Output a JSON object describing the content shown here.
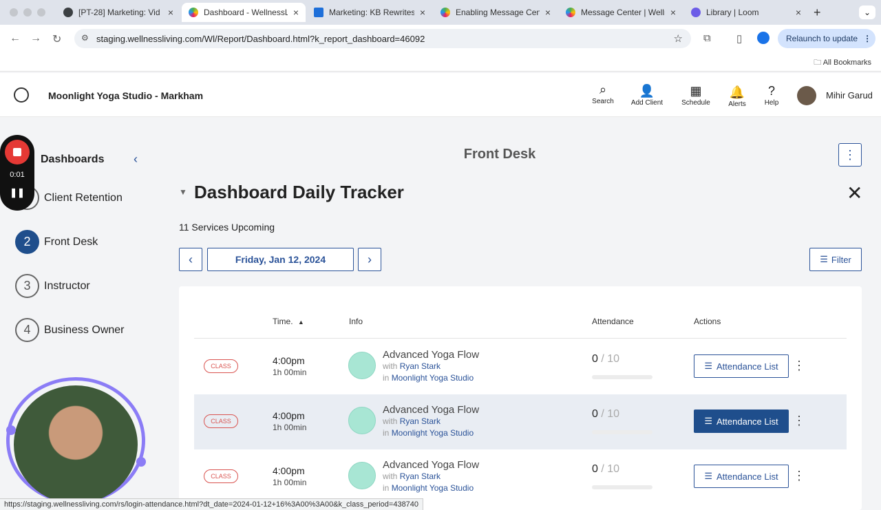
{
  "browser": {
    "tabs": [
      {
        "title": "[PT-28] Marketing: Vid",
        "favicon_color": "#3c4043"
      },
      {
        "title": "Dashboard - WellnessLi",
        "favicon_color": "#4caf50",
        "active": true
      },
      {
        "title": "Marketing: KB Rewrites",
        "favicon_color": "#1e6fd9"
      },
      {
        "title": "Enabling Message Cent",
        "favicon_color": "#8bc34a"
      },
      {
        "title": "Message Center | Welln",
        "favicon_color": "#8bc34a"
      },
      {
        "title": "Library | Loom",
        "favicon_color": "#6c5ce7"
      }
    ],
    "url": "staging.wellnessliving.com/Wl/Report/Dashboard.html?k_report_dashboard=46092",
    "relaunch_label": "Relaunch to update",
    "all_bookmarks_label": "All Bookmarks",
    "status_url": "https://staging.wellnessliving.com/rs/login-attendance.html?dt_date=2024-01-12+16%3A00%3A00&k_class_period=438740"
  },
  "header": {
    "studio_name": "Moonlight Yoga Studio - Markham",
    "nav": [
      {
        "label": "Search",
        "icon": "search-icon"
      },
      {
        "label": "Add Client",
        "icon": "add-user-icon"
      },
      {
        "label": "Schedule",
        "icon": "calendar-icon"
      },
      {
        "label": "Alerts",
        "icon": "bell-icon"
      },
      {
        "label": "Help",
        "icon": "help-icon"
      }
    ],
    "user_name": "Mihir Garud"
  },
  "recorder": {
    "time": "0:01"
  },
  "sidebar": {
    "title": "Dashboards",
    "items": [
      {
        "number": "1",
        "label": "Client Retention"
      },
      {
        "number": "2",
        "label": "Front Desk",
        "active": true
      },
      {
        "number": "3",
        "label": "Instructor"
      },
      {
        "number": "4",
        "label": "Business Owner"
      }
    ]
  },
  "main": {
    "page_title": "Front Desk",
    "tracker_title": "Dashboard Daily Tracker",
    "upcoming": "11 Services Upcoming",
    "date": "Friday, Jan 12, 2024",
    "filter_label": "Filter",
    "columns": {
      "time": "Time.",
      "info": "Info",
      "attendance": "Attendance",
      "actions": "Actions"
    },
    "rows": [
      {
        "badge": "CLASS",
        "time": "4:00pm",
        "duration": "1h 00min",
        "name": "Advanced Yoga Flow",
        "with_prefix": "with",
        "instructor": "Ryan Stark",
        "in_prefix": "in",
        "location": "Moonlight Yoga Studio",
        "attended": "0",
        "capacity": "/ 10",
        "action": "Attendance List"
      },
      {
        "badge": "CLASS",
        "time": "4:00pm",
        "duration": "1h 00min",
        "name": "Advanced Yoga Flow",
        "with_prefix": "with",
        "instructor": "Ryan Stark",
        "in_prefix": "in",
        "location": "Moonlight Yoga Studio",
        "attended": "0",
        "capacity": "/ 10",
        "action": "Attendance List"
      },
      {
        "badge": "CLASS",
        "time": "4:00pm",
        "duration": "1h 00min",
        "name": "Advanced Yoga Flow",
        "with_prefix": "with",
        "instructor": "Ryan Stark",
        "in_prefix": "in",
        "location": "Moonlight Yoga Studio",
        "attended": "0",
        "capacity": "/ 10",
        "action": "Attendance List"
      }
    ]
  },
  "colors": {
    "brand": "#1f4e8c",
    "accent": "#2a5298",
    "badge": "#d9534f"
  }
}
